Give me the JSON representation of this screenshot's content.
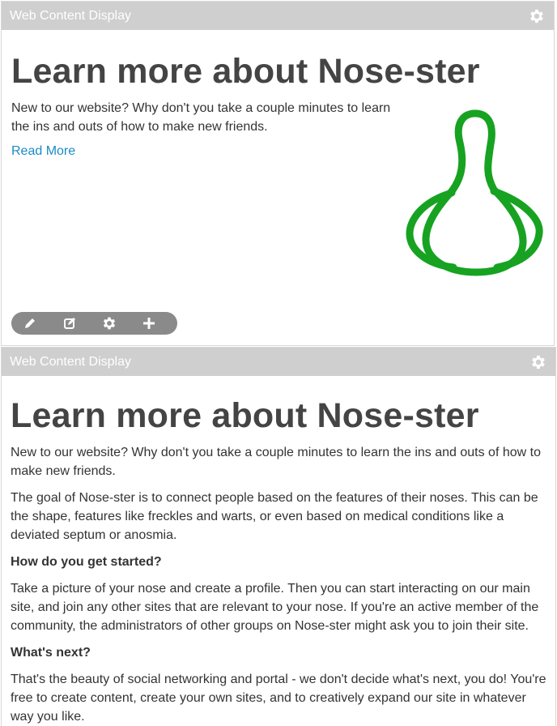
{
  "portlet1": {
    "header_title": "Web Content Display",
    "heading": "Learn more about Nose-ster",
    "intro": "New to our website? Why don't you take a couple minutes to learn the ins and outs of how to make new friends.",
    "read_more": "Read More",
    "image_icon": "nose-outline-image",
    "nose_color": "#17a321",
    "toolbar": [
      "edit-pencil-icon",
      "edit-square-icon",
      "settings-gear-icon",
      "add-plus-icon"
    ]
  },
  "portlet2": {
    "header_title": "Web Content Display",
    "heading": "Learn more about Nose-ster",
    "paragraphs": [
      "New to our website? Why don't you take a couple minutes to learn the ins and outs of how to make new friends.",
      "The goal of Nose-ster is to connect people based on the features of their noses. This can be the shape, features like freckles and warts, or even based on medical conditions like a deviated septum or anosmia.",
      "How do you get started?",
      "Take a picture of your nose and create a profile. Then you can start interacting on our main site, and join any other sites that are relevant to your nose. If you're an active member of the community, the administrators of other groups on Nose-ster might ask you to join their site.",
      "What's next?",
      "That's the beauty of social networking and portal - we don't decide what's next, you do! You're free to create content, create your own sites, and to creatively expand our site in whatever way you like."
    ]
  },
  "colors": {
    "header_bg": "#cfcfcf",
    "link": "#1a8bc8",
    "heading": "#444444"
  }
}
